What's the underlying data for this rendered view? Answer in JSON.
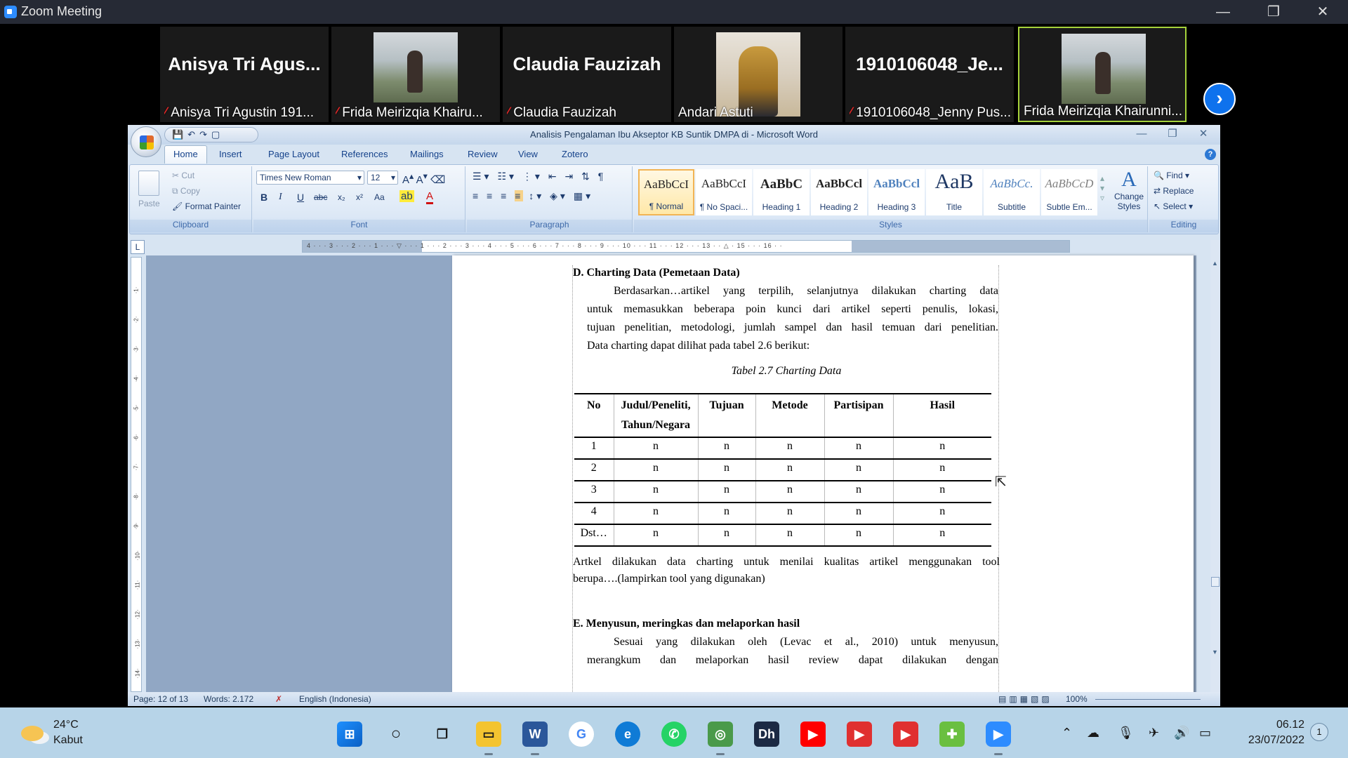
{
  "zoom": {
    "title": "Zoom Meeting",
    "participants": [
      {
        "big_name": "Anisya Tri Agus...",
        "label": "Anisya Tri Agustin 191...",
        "muted": true,
        "video": false
      },
      {
        "big_name": "",
        "label": "Frida Meirizqia Khairu...",
        "muted": true,
        "video": true
      },
      {
        "big_name": "Claudia Fauzizah",
        "label": "Claudia Fauzizah",
        "muted": true,
        "video": false
      },
      {
        "big_name": "",
        "label": "Andari Astuti",
        "muted": false,
        "video": true
      },
      {
        "big_name": "1910106048_Je...",
        "label": "1910106048_Jenny Pus...",
        "muted": true,
        "video": false
      },
      {
        "big_name": "",
        "label": "Frida Meirizqia Khairunni...",
        "muted": false,
        "video": true,
        "active": true
      }
    ],
    "next_icon": "chevron-right-icon"
  },
  "word": {
    "title": "Analisis Pengalaman Ibu Akseptor KB Suntik DMPA di - Microsoft Word",
    "tabs": [
      "Home",
      "Insert",
      "Page Layout",
      "References",
      "Mailings",
      "Review",
      "View",
      "Zotero"
    ],
    "clipboard": {
      "paste": "Paste",
      "cut": "Cut",
      "copy": "Copy",
      "format_painter": "Format Painter",
      "label": "Clipboard"
    },
    "font": {
      "name": "Times New Roman",
      "size": "12",
      "label": "Font",
      "bold": "B",
      "italic": "I",
      "underline": "U",
      "strike": "abc",
      "sub": "x₂",
      "sup": "x²",
      "case": "Aa"
    },
    "paragraph": {
      "label": "Paragraph"
    },
    "styles": {
      "label": "Styles",
      "items": [
        {
          "sample": "AaBbCcI",
          "name": "¶ Normal"
        },
        {
          "sample": "AaBbCcI",
          "name": "¶ No Spaci..."
        },
        {
          "sample": "AaBbC",
          "name": "Heading 1"
        },
        {
          "sample": "AaBbCcl",
          "name": "Heading 2"
        },
        {
          "sample": "AaBbCcl",
          "name": "Heading 3"
        },
        {
          "sample": "AaB",
          "name": "Title"
        },
        {
          "sample": "AaBbCc.",
          "name": "Subtitle"
        },
        {
          "sample": "AaBbCcD",
          "name": "Subtle Em..."
        }
      ],
      "change": "Change Styles"
    },
    "editing": {
      "find": "Find",
      "replace": "Replace",
      "select": "Select",
      "label": "Editing"
    },
    "document": {
      "heading_d": "D. Charting Data (Pemetaan Data)",
      "para1_l1": "Berdasarkan…artikel yang terpilih, selanjutnya dilakukan charting data",
      "para1_l2": "untuk memasukkan beberapa poin kunci dari artikel seperti penulis, lokasi,",
      "para1_l3": "tujuan penelitian, metodologi, jumlah sampel dan hasil temuan dari penelitian.",
      "para1_l4": "Data charting dapat dilihat pada tabel 2.6 berikut:",
      "table_caption": "Tabel 2.7 Charting Data",
      "table_headers": [
        "No",
        "Judul/Peneliti, Tahun/Negara",
        "Tujuan",
        "Metode",
        "Partisipan",
        "Hasil"
      ],
      "table_rows": [
        [
          "1",
          "n",
          "n",
          "n",
          "n",
          "n"
        ],
        [
          "2",
          "n",
          "n",
          "n",
          "n",
          "n"
        ],
        [
          "3",
          "n",
          "n",
          "n",
          "n",
          "n"
        ],
        [
          "4",
          "n",
          "n",
          "n",
          "n",
          "n"
        ],
        [
          "Dst…",
          "n",
          "n",
          "n",
          "n",
          "n"
        ]
      ],
      "para2_l1": "Artkel dilakukan data charting untuk menilai kualitas artikel menggunakan tool",
      "para2_l2": "berupa….(lampirkan tool yang digunakan)",
      "heading_e": "E. Menyusun, meringkas dan melaporkan hasil",
      "para3_l1": "Sesuai yang dilakukan oleh (Levac et al., 2010) untuk menyusun,",
      "para3_l2": "merangkum dan melaporkan hasil review dapat dilakukan dengan"
    },
    "status": {
      "page": "Page: 12 of 13",
      "words": "Words: 2.172",
      "language": "English (Indonesia)",
      "zoom": "100%"
    }
  },
  "taskbar": {
    "weather_temp": "24°C",
    "weather_cond": "Kabut",
    "time": "06.12",
    "date": "23/07/2022",
    "notifications": "1"
  }
}
